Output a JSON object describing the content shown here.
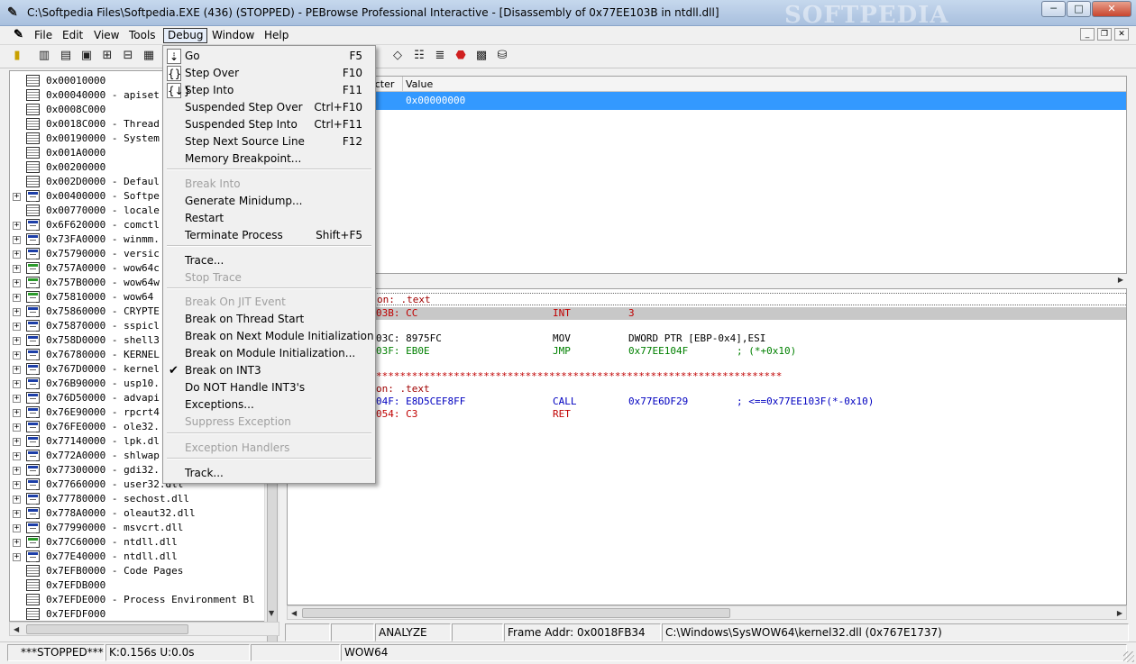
{
  "window": {
    "title": "C:\\Softpedia Files\\Softpedia.EXE (436) (STOPPED) - PEBrowse Professional Interactive - [Disassembly of 0x77EE103B in ntdll.dll]",
    "watermark": "SOFTPEDIA",
    "minimize": "─",
    "maximize": "□",
    "close": "✕"
  },
  "menubar": {
    "items": [
      "File",
      "Edit",
      "View",
      "Tools",
      "Debug",
      "Window",
      "Help"
    ],
    "mdi": {
      "minimize": "_",
      "restore": "❐",
      "close": "✕"
    }
  },
  "toolbar": {
    "icons": [
      "exit-icon",
      "chart-icon",
      "page-icon",
      "folder-icon",
      "tree-icon",
      "dependency-icon",
      "tool-icon",
      "disasm-icon",
      "list-icon",
      "lines-icon",
      "stop-icon",
      "chip-icon",
      "module-icon"
    ],
    "glyphs": [
      "▮",
      "▥",
      "▤",
      "▣",
      "⊞",
      "⊟",
      "▦",
      "◇",
      "☷",
      "≣",
      "⬣",
      "▩",
      "⛁"
    ]
  },
  "debug_menu": {
    "items": [
      {
        "label": "Go",
        "shortcut": "F5",
        "icon": "⇣",
        "enabled": true
      },
      {
        "label": "Step Over",
        "shortcut": "F10",
        "icon": "{}",
        "enabled": true
      },
      {
        "label": "Step Into",
        "shortcut": "F11",
        "icon": "{↓}",
        "enabled": true
      },
      {
        "label": "Suspended Step Over",
        "shortcut": "Ctrl+F10",
        "enabled": true
      },
      {
        "label": "Suspended Step Into",
        "shortcut": "Ctrl+F11",
        "enabled": true
      },
      {
        "label": "Step Next Source Line",
        "shortcut": "F12",
        "enabled": true
      },
      {
        "label": "Memory Breakpoint...",
        "shortcut": "",
        "enabled": true
      },
      {
        "label": "Break Into",
        "shortcut": "",
        "enabled": false
      },
      {
        "label": "Generate Minidump...",
        "shortcut": "",
        "enabled": true
      },
      {
        "label": "Restart",
        "shortcut": "",
        "enabled": true
      },
      {
        "label": "Terminate Process",
        "shortcut": "Shift+F5",
        "enabled": true
      },
      {
        "label": "Trace...",
        "shortcut": "",
        "enabled": true
      },
      {
        "label": "Stop Trace",
        "shortcut": "",
        "enabled": false
      },
      {
        "label": "Break On JIT Event",
        "shortcut": "",
        "enabled": false
      },
      {
        "label": "Break on Thread Start",
        "shortcut": "",
        "enabled": true
      },
      {
        "label": "Break on Next Module Initialization",
        "shortcut": "",
        "enabled": true
      },
      {
        "label": "Break on Module Initialization...",
        "shortcut": "",
        "enabled": true
      },
      {
        "label": "Break on INT3",
        "shortcut": "",
        "enabled": true,
        "checked": true
      },
      {
        "label": "Do NOT Handle INT3's",
        "shortcut": "",
        "enabled": true
      },
      {
        "label": "Exceptions...",
        "shortcut": "",
        "enabled": true
      },
      {
        "label": "Suppress Exception",
        "shortcut": "",
        "enabled": false
      },
      {
        "label": "Exception Handlers",
        "shortcut": "",
        "enabled": false
      },
      {
        "label": "Track...",
        "shortcut": "",
        "enabled": true
      }
    ]
  },
  "tree": {
    "rows": [
      {
        "text": "0x00010000",
        "kind": "mem",
        "expandable": false
      },
      {
        "text": "0x00040000 - apiset",
        "kind": "mem",
        "expandable": false
      },
      {
        "text": "0x0008C000",
        "kind": "mem",
        "expandable": false
      },
      {
        "text": "0x0018C000 - Thread",
        "kind": "mem",
        "expandable": false
      },
      {
        "text": "0x00190000 - System",
        "kind": "mem",
        "expandable": false
      },
      {
        "text": "0x001A0000",
        "kind": "mem",
        "expandable": false
      },
      {
        "text": "0x00200000",
        "kind": "mem",
        "expandable": false
      },
      {
        "text": "0x002D0000 - Defaul",
        "kind": "mem",
        "expandable": false
      },
      {
        "text": "0x00400000 - Softpe",
        "kind": "mod",
        "expandable": true
      },
      {
        "text": "0x00770000 - locale",
        "kind": "mem",
        "expandable": false
      },
      {
        "text": "0x6F620000 - comctl",
        "kind": "mod",
        "expandable": true
      },
      {
        "text": "0x73FA0000 - winmm.",
        "kind": "mod",
        "expandable": true
      },
      {
        "text": "0x75790000 - versic",
        "kind": "mod",
        "expandable": true
      },
      {
        "text": "0x757A0000 - wow64c",
        "kind": "mod-green",
        "expandable": true
      },
      {
        "text": "0x757B0000 - wow64w",
        "kind": "mod-green",
        "expandable": true
      },
      {
        "text": "0x75810000 - wow64",
        "kind": "mod-green",
        "expandable": true
      },
      {
        "text": "0x75860000 - CRYPTE",
        "kind": "mod",
        "expandable": true
      },
      {
        "text": "0x75870000 - sspicl",
        "kind": "mod",
        "expandable": true
      },
      {
        "text": "0x758D0000 - shell3",
        "kind": "mod",
        "expandable": true
      },
      {
        "text": "0x76780000 - KERNEL",
        "kind": "mod",
        "expandable": true
      },
      {
        "text": "0x767D0000 - kernel",
        "kind": "mod",
        "expandable": true
      },
      {
        "text": "0x76B90000 - usp10.",
        "kind": "mod",
        "expandable": true
      },
      {
        "text": "0x76D50000 - advapi",
        "kind": "mod",
        "expandable": true
      },
      {
        "text": "0x76E90000 - rpcrt4",
        "kind": "mod",
        "expandable": true
      },
      {
        "text": "0x76FE0000 - ole32.",
        "kind": "mod",
        "expandable": true
      },
      {
        "text": "0x77140000 - lpk.dl",
        "kind": "mod",
        "expandable": true
      },
      {
        "text": "0x772A0000 - shlwap",
        "kind": "mod",
        "expandable": true
      },
      {
        "text": "0x77300000 - gdi32.",
        "kind": "mod",
        "expandable": true
      },
      {
        "text": "0x77660000 - user32.dll",
        "kind": "mod",
        "expandable": true
      },
      {
        "text": "0x77780000 - sechost.dll",
        "kind": "mod",
        "expandable": true
      },
      {
        "text": "0x778A0000 - oleaut32.dll",
        "kind": "mod",
        "expandable": true
      },
      {
        "text": "0x77990000 - msvcrt.dll",
        "kind": "mod",
        "expandable": true
      },
      {
        "text": "0x77C60000 - ntdll.dll",
        "kind": "mod-green",
        "expandable": true
      },
      {
        "text": "0x77E40000 - ntdll.dll",
        "kind": "mod",
        "expandable": true
      },
      {
        "text": "0x7EFB0000 - Code Pages",
        "kind": "mem",
        "expandable": false
      },
      {
        "text": "0x7EFDB000",
        "kind": "mem",
        "expandable": false
      },
      {
        "text": "0x7EFDE000 - Process Environment Bl",
        "kind": "mem",
        "expandable": false
      },
      {
        "text": "0x7EFDF000",
        "kind": "mem",
        "expandable": false
      }
    ]
  },
  "registers": {
    "header_register": "acter",
    "header_value": "Value",
    "selected_value": "0x00000000"
  },
  "disassembly": {
    "lines": [
      {
        "addr": "on: .text",
        "addr_color": "#a00000",
        "hex": "",
        "hex_color": "",
        "mnemonic": "",
        "operand": "",
        "comment": "",
        "color": "#a00000",
        "style": "section"
      },
      {
        "addr": "03B: CC",
        "addr_color": "#c00000",
        "hex": "",
        "hex_color": "",
        "mnemonic": "INT",
        "operand": "3",
        "comment": "",
        "color": "#c00000",
        "style": "current"
      },
      {
        "addr": "",
        "addr_color": "",
        "hex": "",
        "hex_color": "",
        "mnemonic": "",
        "operand": "",
        "comment": "",
        "color": "",
        "style": ""
      },
      {
        "addr": "03C: 8975FC",
        "addr_color": "#000000",
        "hex": "",
        "hex_color": "",
        "mnemonic": "MOV",
        "operand": "DWORD PTR [EBP-0x4],ESI",
        "comment": "",
        "color": "#000000",
        "style": ""
      },
      {
        "addr": "03F: EB0E",
        "addr_color": "#008000",
        "hex": "",
        "hex_color": "",
        "mnemonic": "JMP",
        "operand": "0x77EE104F",
        "comment": "; (*+0x10)",
        "color": "#008000",
        "style": ""
      },
      {
        "addr": "",
        "addr_color": "",
        "hex": "",
        "hex_color": "",
        "mnemonic": "",
        "operand": "",
        "comment": "",
        "color": "",
        "style": ""
      },
      {
        "addr": "********************************************************************",
        "addr_color": "#c00000",
        "hex": "",
        "hex_color": "",
        "mnemonic": "",
        "operand": "",
        "comment": "",
        "color": "#c00000",
        "style": "stars"
      },
      {
        "addr": "on: .text",
        "addr_color": "#a00000",
        "hex": "",
        "hex_color": "",
        "mnemonic": "",
        "operand": "",
        "comment": "",
        "color": "#a00000",
        "style": ""
      },
      {
        "addr": "04F: E8D5CEF8FF",
        "addr_color": "#0000c0",
        "hex": "",
        "hex_color": "",
        "mnemonic": "CALL",
        "operand": "0x77E6DF29",
        "comment": "; <==0x77EE103F(*-0x10)",
        "color": "#0000c0",
        "style": ""
      },
      {
        "addr": "054: C3",
        "addr_color": "#c00000",
        "hex": "",
        "hex_color": "",
        "mnemonic": "RET",
        "operand": "",
        "comment": "",
        "color": "#c00000",
        "style": ""
      }
    ]
  },
  "infobar": {
    "mode": "ANALYZE",
    "frame": "Frame Addr: 0x0018FB34",
    "location": "C:\\Windows\\SysWOW64\\kernel32.dll (0x767E1737)"
  },
  "statusbar": {
    "state": "***STOPPED***",
    "times": "K:0.156s U:0.0s",
    "mode": "WOW64"
  }
}
